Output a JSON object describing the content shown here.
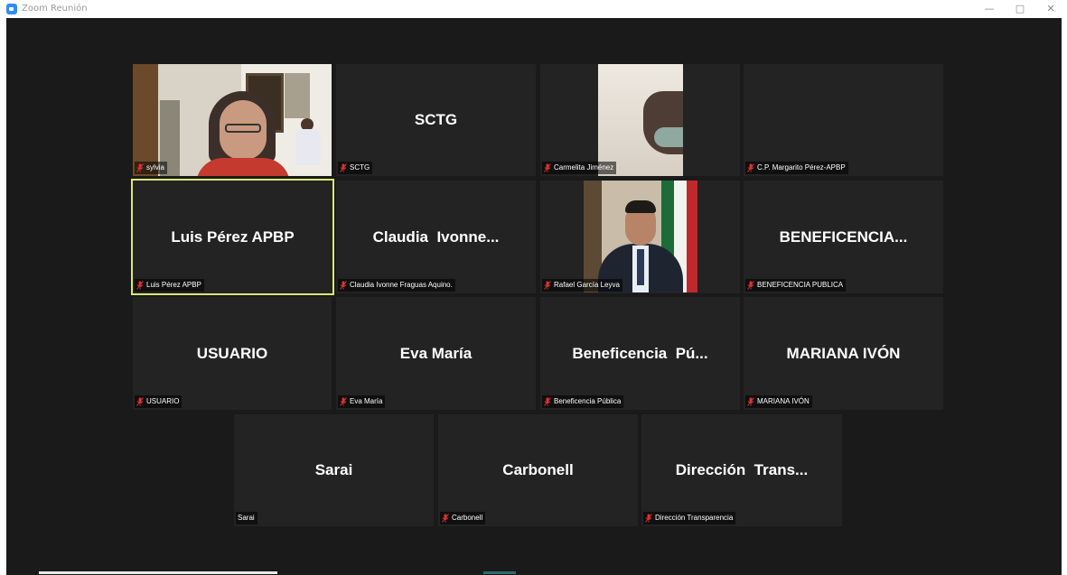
{
  "window": {
    "title": "Zoom Reunión",
    "controls": {
      "minimize": "—",
      "maximize": "□",
      "close": "✕"
    }
  },
  "icons": {
    "app": "zoom-camera-icon",
    "muted_mic": "muted-microphone-icon"
  },
  "colors": {
    "meeting_background": "#1a1a1a",
    "tile_background": "#232323",
    "active_speaker_border": "#d9e876",
    "muted_icon": "#e0322f"
  },
  "participants": [
    {
      "display_name": "",
      "label": "sylvia",
      "muted": true,
      "video": true,
      "active": false
    },
    {
      "display_name": "SCTG",
      "label": "SCTG",
      "muted": true,
      "video": false,
      "active": false
    },
    {
      "display_name": "",
      "label": "Carmelita Jiménez",
      "muted": true,
      "video": true,
      "active": false
    },
    {
      "display_name": "",
      "label": "C.P. Margarito Pérez-APBP",
      "muted": true,
      "video": false,
      "active": false
    },
    {
      "display_name": "Luis Pérez APBP",
      "label": "Luis Pérez APBP",
      "muted": true,
      "video": false,
      "active": true
    },
    {
      "display_name": "Claudia  Ivonne...",
      "label": "Claudia Ivonne Fraguas Aquino.",
      "muted": true,
      "video": false,
      "active": false
    },
    {
      "display_name": "",
      "label": "Rafael García Leyva",
      "muted": true,
      "video": true,
      "active": false
    },
    {
      "display_name": "BENEFICENCIA...",
      "label": "BENEFICENCIA PUBLICA",
      "muted": true,
      "video": false,
      "active": false
    },
    {
      "display_name": "USUARIO",
      "label": "USUARIO",
      "muted": true,
      "video": false,
      "active": false
    },
    {
      "display_name": "Eva María",
      "label": "Eva María",
      "muted": true,
      "video": false,
      "active": false
    },
    {
      "display_name": "Beneficencia  Pú...",
      "label": "Beneficencia Pública",
      "muted": true,
      "video": false,
      "active": false
    },
    {
      "display_name": "MARIANA IVÓN",
      "label": "MARIANA IVÓN",
      "muted": true,
      "video": false,
      "active": false
    },
    {
      "display_name": "Sarai",
      "label": "Sarai",
      "muted": false,
      "video": false,
      "active": false
    },
    {
      "display_name": "Carbonell",
      "label": "Carbonell",
      "muted": true,
      "video": false,
      "active": false
    },
    {
      "display_name": "Dirección  Trans...",
      "label": "Dirección Transparencia",
      "muted": true,
      "video": false,
      "active": false
    }
  ]
}
